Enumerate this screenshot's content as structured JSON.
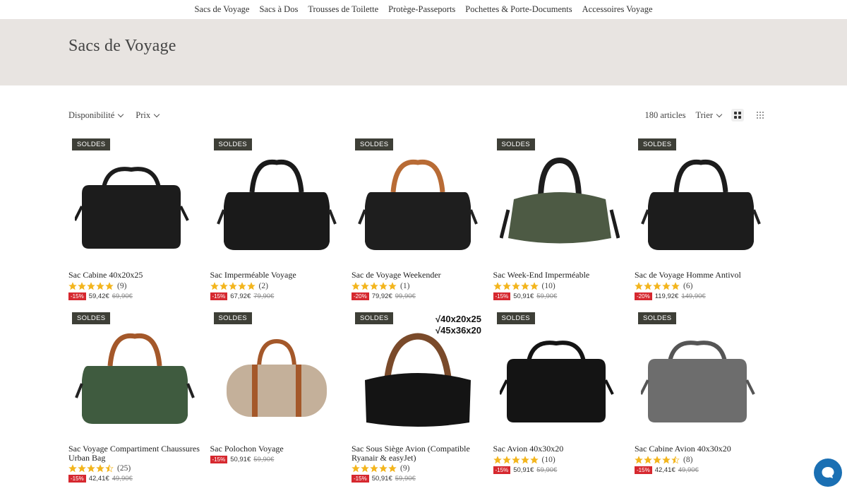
{
  "nav": [
    "Sacs de Voyage",
    "Sacs à Dos",
    "Trousses de Toilette",
    "Protège-Passeports",
    "Pochettes & Porte-Documents",
    "Accessoires Voyage"
  ],
  "page": {
    "title": "Sacs de Voyage"
  },
  "filters": {
    "availability": "Disponibilité",
    "price": "Prix",
    "count": "180 articles",
    "sort": "Trier"
  },
  "badge_label": "SOLDES",
  "products": [
    {
      "title": "Sac Cabine 40x20x25",
      "rating": 5,
      "reviews": "(9)",
      "discount": "-15%",
      "price": "59,42€",
      "old_price": "69,90€",
      "bag_color": "#1c1c1c",
      "strap_color": "#1c1c1c",
      "shape": "cabin"
    },
    {
      "title": "Sac Imperméable Voyage",
      "rating": 5,
      "reviews": "(2)",
      "discount": "-15%",
      "price": "67,92€",
      "old_price": "79,90€",
      "bag_color": "#1a1a1a",
      "strap_color": "#1a1a1a",
      "shape": "duffel"
    },
    {
      "title": "Sac de Voyage Weekender",
      "rating": 5,
      "reviews": "(1)",
      "discount": "-20%",
      "price": "79,92€",
      "old_price": "99,90€",
      "bag_color": "#1e1e1e",
      "strap_color": "#b86b35",
      "shape": "duffel"
    },
    {
      "title": "Sac Week-End Imperméable",
      "rating": 5,
      "reviews": "(10)",
      "discount": "-15%",
      "price": "50,91€",
      "old_price": "59,90€",
      "bag_color": "#4d5a44",
      "strap_color": "#1d1d1d",
      "shape": "round"
    },
    {
      "title": "Sac de Voyage Homme Antivol",
      "rating": 5,
      "reviews": "(6)",
      "discount": "-20%",
      "price": "119,92€",
      "old_price": "149,90€",
      "bag_color": "#1c1c1c",
      "strap_color": "#1c1c1c",
      "shape": "duffel"
    },
    {
      "title": "Sac Voyage Compartiment Chaussures Urban Bag",
      "rating": 4.5,
      "reviews": "(25)",
      "discount": "-15%",
      "price": "42,41€",
      "old_price": "49,90€",
      "bag_color": "#3f5b3f",
      "strap_color": "#a4582a",
      "shape": "duffel"
    },
    {
      "title": "Sac Polochon Voyage",
      "rating": 0,
      "reviews": "",
      "discount": "-15%",
      "price": "50,91€",
      "old_price": "59,90€",
      "bag_color": "#c4b09a",
      "strap_color": "#a4582a",
      "shape": "barrel"
    },
    {
      "title": "Sac Sous Siège Avion (Compatible Ryanair & easyJet)",
      "rating": 5,
      "reviews": "(9)",
      "discount": "-15%",
      "price": "50,91€",
      "old_price": "59,90€",
      "bag_color": "#141414",
      "strap_color": "#7a4a2a",
      "shape": "tote",
      "overlay": [
        "√40x20x25",
        "√45x36x20"
      ]
    },
    {
      "title": "Sac Avion 40x30x20",
      "rating": 5,
      "reviews": "(10)",
      "discount": "-15%",
      "price": "50,91€",
      "old_price": "59,90€",
      "bag_color": "#141414",
      "strap_color": "#141414",
      "shape": "cabin"
    },
    {
      "title": "Sac Cabine Avion 40x30x20",
      "rating": 4.5,
      "reviews": "(8)",
      "discount": "-15%",
      "price": "42,41€",
      "old_price": "49,90€",
      "bag_color": "#6d6d6d",
      "strap_color": "#555555",
      "shape": "cabin"
    }
  ],
  "colors": {
    "banner": "#e8e4e1",
    "badge": "#3e3f37",
    "discount": "#d6282f",
    "star": "#f3b51d",
    "chat": "#1a6fb3"
  }
}
